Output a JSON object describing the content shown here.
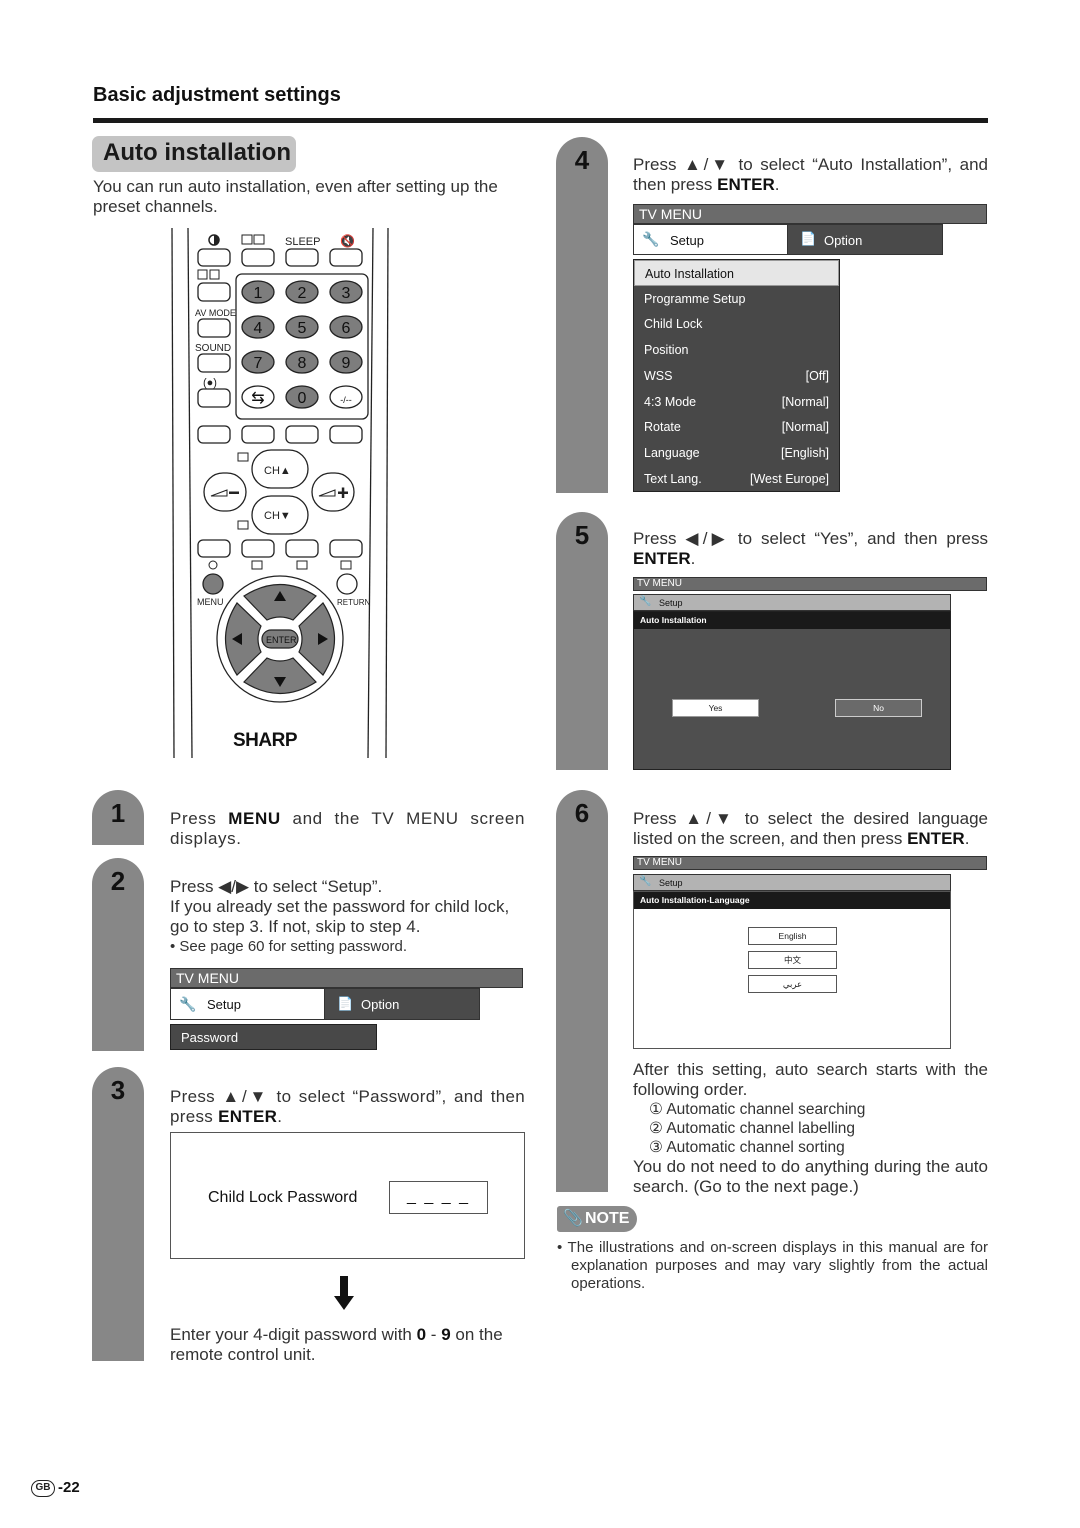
{
  "page": {
    "section_title": "Basic adjustment settings",
    "heading": "Auto installation",
    "intro": "You can run auto installation, even after setting up the preset channels.",
    "page_number": "-22",
    "region_badge": "GB"
  },
  "remote": {
    "top_labels": [
      "SLEEP"
    ],
    "side_labels": [
      "AV MODE",
      "SOUND"
    ],
    "number_keys": [
      "1",
      "2",
      "3",
      "4",
      "5",
      "6",
      "7",
      "8",
      "9",
      "0",
      "-/--"
    ],
    "ch_up": "CH▲",
    "ch_down": "CH▼",
    "menu_label": "MENU",
    "return_label": "RETURN",
    "enter_label": "ENTER",
    "brand": "SHARP"
  },
  "steps": [
    {
      "number": "1",
      "text_pre": "Press ",
      "text_bold": "MENU",
      "text_post": " and the TV MENU screen displays."
    },
    {
      "number": "2",
      "line1": "Press ◀/▶ to select “Setup”.",
      "line2": "If you already set the password for child lock, go to step 3. If not, skip to step 4.",
      "bullet": "• See page 60 for setting password.",
      "menu": {
        "title": "TV MENU",
        "tab_setup": "Setup",
        "tab_option": "Option",
        "item": "Password"
      }
    },
    {
      "number": "3",
      "text_pre": "Press ▲/▼ to select “Password”, and then press ",
      "text_bold": "ENTER",
      "text_post": ".",
      "dialog_label": "Child Lock Password",
      "dialog_value": "_ _ _ _",
      "after_pre": "Enter your 4-digit password with ",
      "after_b1": "0",
      "after_mid": " - ",
      "after_b2": "9",
      "after_post": " on the remote control unit."
    },
    {
      "number": "4",
      "text_pre": "Press ▲/▼ to select “Auto Installation”, and then press ",
      "text_bold": "ENTER",
      "text_post": ".",
      "menu": {
        "title": "TV MENU",
        "tab_setup": "Setup",
        "tab_option": "Option",
        "items": [
          {
            "label": "Auto Installation",
            "value": ""
          },
          {
            "label": "Programme Setup",
            "value": ""
          },
          {
            "label": "Child Lock",
            "value": ""
          },
          {
            "label": "Position",
            "value": ""
          },
          {
            "label": "WSS",
            "value": "[Off]"
          },
          {
            "label": "4:3 Mode",
            "value": "[Normal]"
          },
          {
            "label": "Rotate",
            "value": "[Normal]"
          },
          {
            "label": "Language",
            "value": "[English]"
          },
          {
            "label": "Text Lang.",
            "value": "[West Europe]"
          }
        ]
      }
    },
    {
      "number": "5",
      "text_pre": "Press ◀/▶ to select “Yes”, and then press ",
      "text_bold": "ENTER",
      "text_post": ".",
      "menu": {
        "title": "TV MENU",
        "tab_setup": "Setup",
        "bar": "Auto Installation",
        "yes": "Yes",
        "no": "No"
      }
    },
    {
      "number": "6",
      "text_pre": "Press ▲/▼ to select the desired language listed on the screen, and then press ",
      "text_bold": "ENTER",
      "text_post": ".",
      "menu": {
        "title": "TV MENU",
        "tab_setup": "Setup",
        "bar": "Auto Installation-Language",
        "languages": [
          "English",
          "中文",
          "عربي"
        ]
      },
      "after": "After this setting, auto search starts with the following order.",
      "order": [
        "① Automatic channel searching",
        "② Automatic channel labelling",
        "③ Automatic channel sorting"
      ],
      "closing": "You do not need to do anything during the auto search. (Go to the next page.)"
    }
  ],
  "note": {
    "label": "NOTE",
    "text": "• The illustrations and on-screen displays in this manual are for explanation purposes and may vary slightly from the actual operations."
  }
}
